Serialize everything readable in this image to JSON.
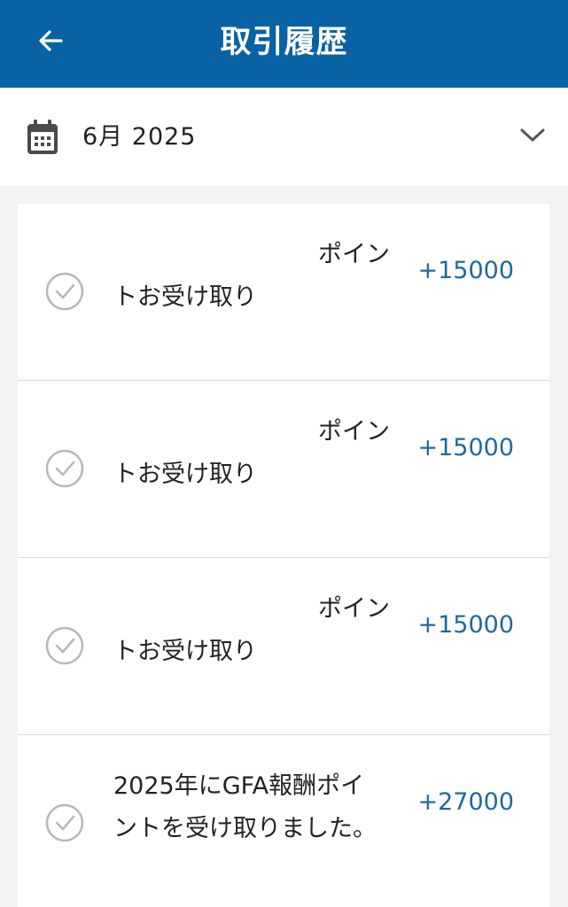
{
  "header": {
    "title": "取引履歴",
    "back_icon": "arrow-left-icon",
    "background": "#0862a4"
  },
  "month_selector": {
    "label": "6月 2025",
    "calendar_icon": "calendar-icon",
    "chevron_icon": "chevron-down-icon"
  },
  "transactions": [
    {
      "desc_line1": "ポイン",
      "desc_line2": "トお受け取り",
      "amount": "+15000"
    },
    {
      "desc_line1": "ポイン",
      "desc_line2": "トお受け取り",
      "amount": "+15000"
    },
    {
      "desc_line1": "ポイン",
      "desc_line2": "トお受け取り",
      "amount": "+15000"
    },
    {
      "desc_line1": "2025年にGFA報酬ポイ",
      "desc_line2": "ントを受け取りました。",
      "amount": "+27000"
    }
  ],
  "colors": {
    "accent": "#1e6a9d",
    "check": "#b8b8b8"
  }
}
